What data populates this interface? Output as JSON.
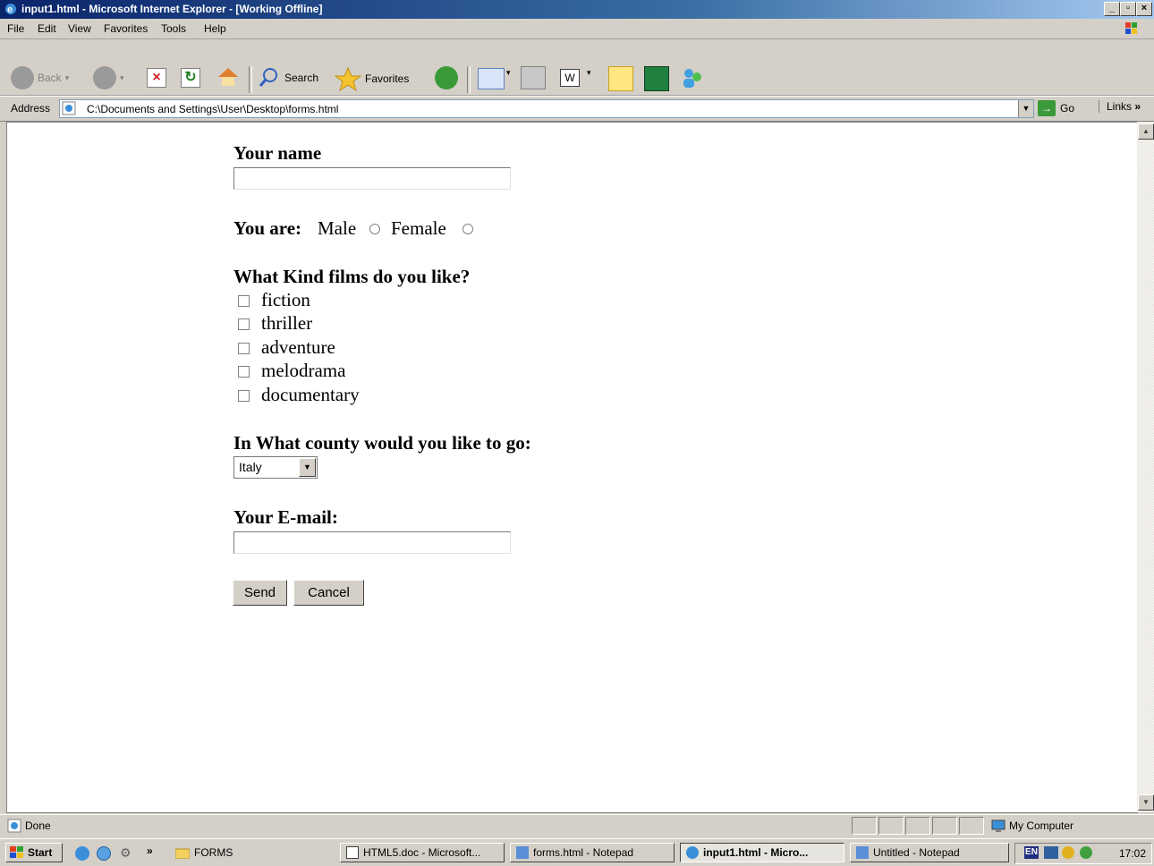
{
  "window": {
    "title": "input1.html - Microsoft Internet Explorer - [Working Offline]",
    "controls": [
      "_",
      "ő",
      "×"
    ]
  },
  "menu": [
    "File",
    "Edit",
    "View",
    "Favorites",
    "Tools",
    "Help"
  ],
  "toolbar": {
    "back_label": "Back",
    "search_label": "Search",
    "favorites_label": "Favorites"
  },
  "address": {
    "label": "Address",
    "value": "C:\\Documents and Settings\\User\\Desktop\\forms.html",
    "go_label": "Go",
    "links_label": "Links"
  },
  "form": {
    "name_label": "Your name",
    "name_value": "",
    "gender_label": "You are:",
    "gender_options": [
      "Male",
      "Female"
    ],
    "films_label": "What Kind films do you like?",
    "films_options": [
      "fiction",
      "thriller",
      "adventure",
      "melodrama",
      "documentary"
    ],
    "country_label": "In What county would you like to go:",
    "country_selected": "Italy",
    "email_label": "Your E-mail:",
    "email_value": "",
    "send_label": "Send",
    "cancel_label": "Cancel"
  },
  "status": {
    "text": "Done",
    "zone": "My Computer"
  },
  "taskbar": {
    "start_label": "Start",
    "overflow": "»",
    "folder_label": "FORMS",
    "items": [
      "HTML5.doc - Microsoft...",
      "forms.html - Notepad",
      "input1.html - Micro...",
      "Untitled - Notepad"
    ],
    "active_index": 2,
    "lang": "EN",
    "clock": "17:02"
  }
}
